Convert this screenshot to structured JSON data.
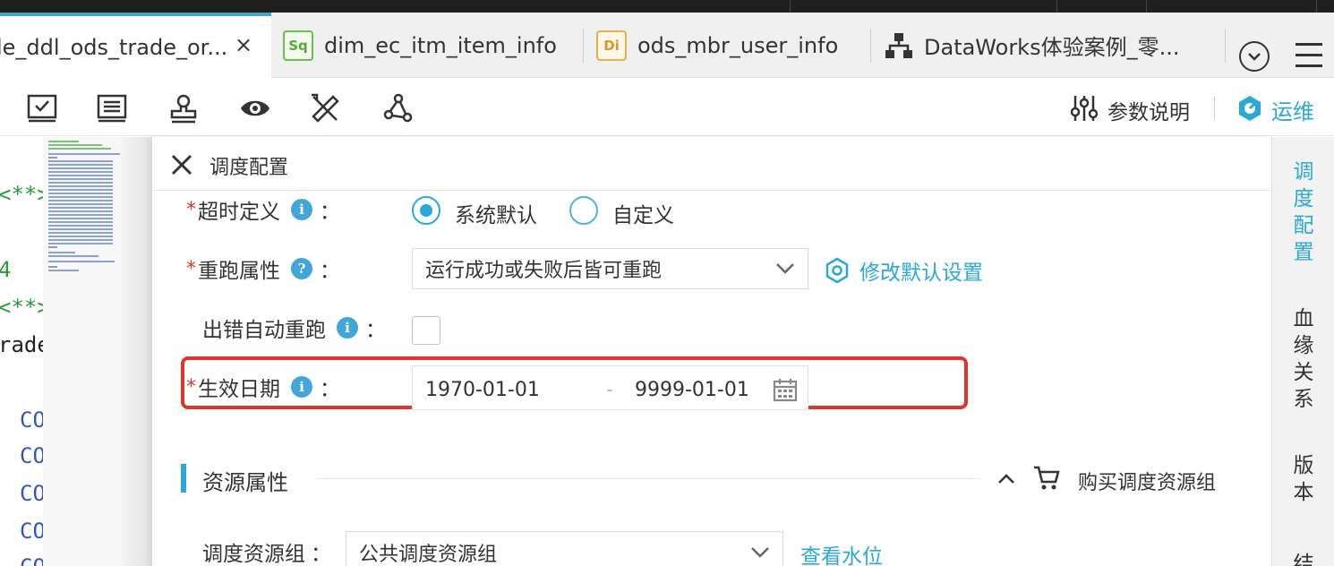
{
  "tabs": [
    {
      "badge": "",
      "label": "le_ddl_ods_trade_or...",
      "close": "×",
      "active": true
    },
    {
      "badge": "Sq",
      "label": "dim_ec_itm_item_info",
      "active": false
    },
    {
      "badge": "Di",
      "label": "ods_mbr_user_info",
      "active": false
    },
    {
      "badge": "",
      "label": "DataWorks体验案例_零...",
      "icon": "sitemap-icon",
      "active": false
    }
  ],
  "toolbar": {
    "icons": [
      "check-square-icon",
      "list-document-icon",
      "stamp-icon",
      "eye-icon",
      "ruler-pencil-icon",
      "node-graph-icon"
    ],
    "param_label": "参数说明",
    "ops_label": "运维"
  },
  "editor": {
    "lines": [
      {
        "text": "<**>",
        "color": "#2a9d3a"
      },
      {
        "text": "4",
        "color": "#2a9d3a"
      },
      {
        "text": "<**>",
        "color": "#2a9d3a"
      },
      {
        "text": "rade",
        "color": "#222222"
      },
      {
        "text": "CO",
        "color": "#2f55c7"
      },
      {
        "text": "CO",
        "color": "#2f55c7"
      },
      {
        "text": "CO",
        "color": "#2f55c7"
      },
      {
        "text": "CO",
        "color": "#2f55c7"
      },
      {
        "text": "CO",
        "color": "#2f55c7"
      }
    ]
  },
  "panel": {
    "title": "调度配置",
    "timeout": {
      "label": "超时定义",
      "info": "i",
      "colon": "：",
      "options": [
        {
          "label": "系统默认",
          "selected": true
        },
        {
          "label": "自定义",
          "selected": false
        }
      ]
    },
    "rerun": {
      "label": "重跑属性",
      "info": "?",
      "colon": "：",
      "value": "运行成功或失败后皆可重跑",
      "link": "修改默认设置"
    },
    "auto_rerun": {
      "label": "出错自动重跑",
      "info": "i",
      "colon": "：",
      "checked": false
    },
    "effective_date": {
      "label": "生效日期",
      "info": "i",
      "colon": "：",
      "start": "1970-01-01",
      "separator": "-",
      "end": "9999-01-01"
    },
    "resource_section": {
      "title": "资源属性",
      "collapse": "^",
      "buy_label": "购买调度资源组"
    },
    "resource_group": {
      "label": "调度资源组",
      "colon": "：",
      "value": "公共调度资源组",
      "link": "查看水位"
    }
  },
  "right_tabs": [
    {
      "label": "调度配置",
      "active": true
    },
    {
      "label": "血缘关系",
      "active": false
    },
    {
      "label": "版本",
      "active": false
    },
    {
      "label": "结",
      "active": false
    }
  ],
  "colors": {
    "accent": "#2aa8d8",
    "required": "#e0352b",
    "tab_active_border": "#45a7c8",
    "highlight_border": "#e0352b"
  }
}
